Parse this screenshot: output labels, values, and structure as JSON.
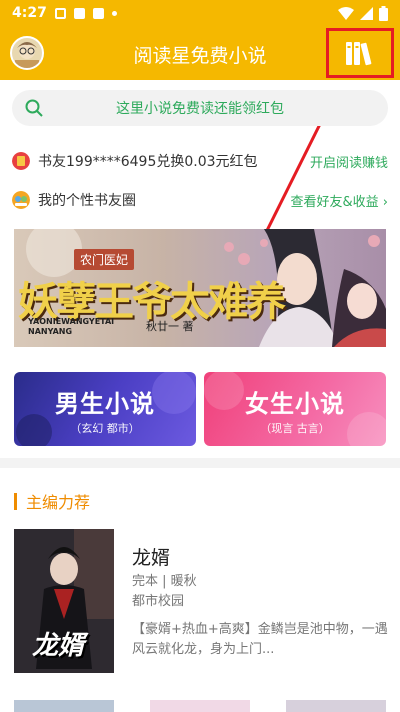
{
  "status_bar": {
    "time": "4:27",
    "a_label": "A"
  },
  "header": {
    "title": "阅读星免费小说"
  },
  "search": {
    "placeholder_text": "这里小说免费读还能领红包"
  },
  "notices": [
    {
      "text": "书友199****6495兑换0.03元红包",
      "link": "开启阅读赚钱"
    },
    {
      "text": "我的个性书友圈",
      "link": "查看好友&收益 ›"
    }
  ],
  "banner": {
    "subtitle": "农门医妃",
    "title": "妖孽王爷太难养",
    "pinyin": "YAONIEWANGYETAI NANYANG",
    "author": "秋廿一 著"
  },
  "categories": [
    {
      "title": "男生小说",
      "sub": "（玄幻 都市）"
    },
    {
      "title": "女生小说",
      "sub": "（现言 古言）"
    }
  ],
  "section": {
    "title": "主编力荐"
  },
  "book": {
    "title": "龙婿",
    "meta": "完本 | 暖秋",
    "category": "都市校园",
    "description": "【豪婿+热血+高爽】金鳞岂是池中物，一遇风云就化龙，身为上门...",
    "cover_text": "龙婿"
  },
  "colors": {
    "brand": "#f5b800",
    "accent_green": "#2eaa5c",
    "section_orange": "#ef8c00",
    "highlight_red": "#e51c23"
  }
}
